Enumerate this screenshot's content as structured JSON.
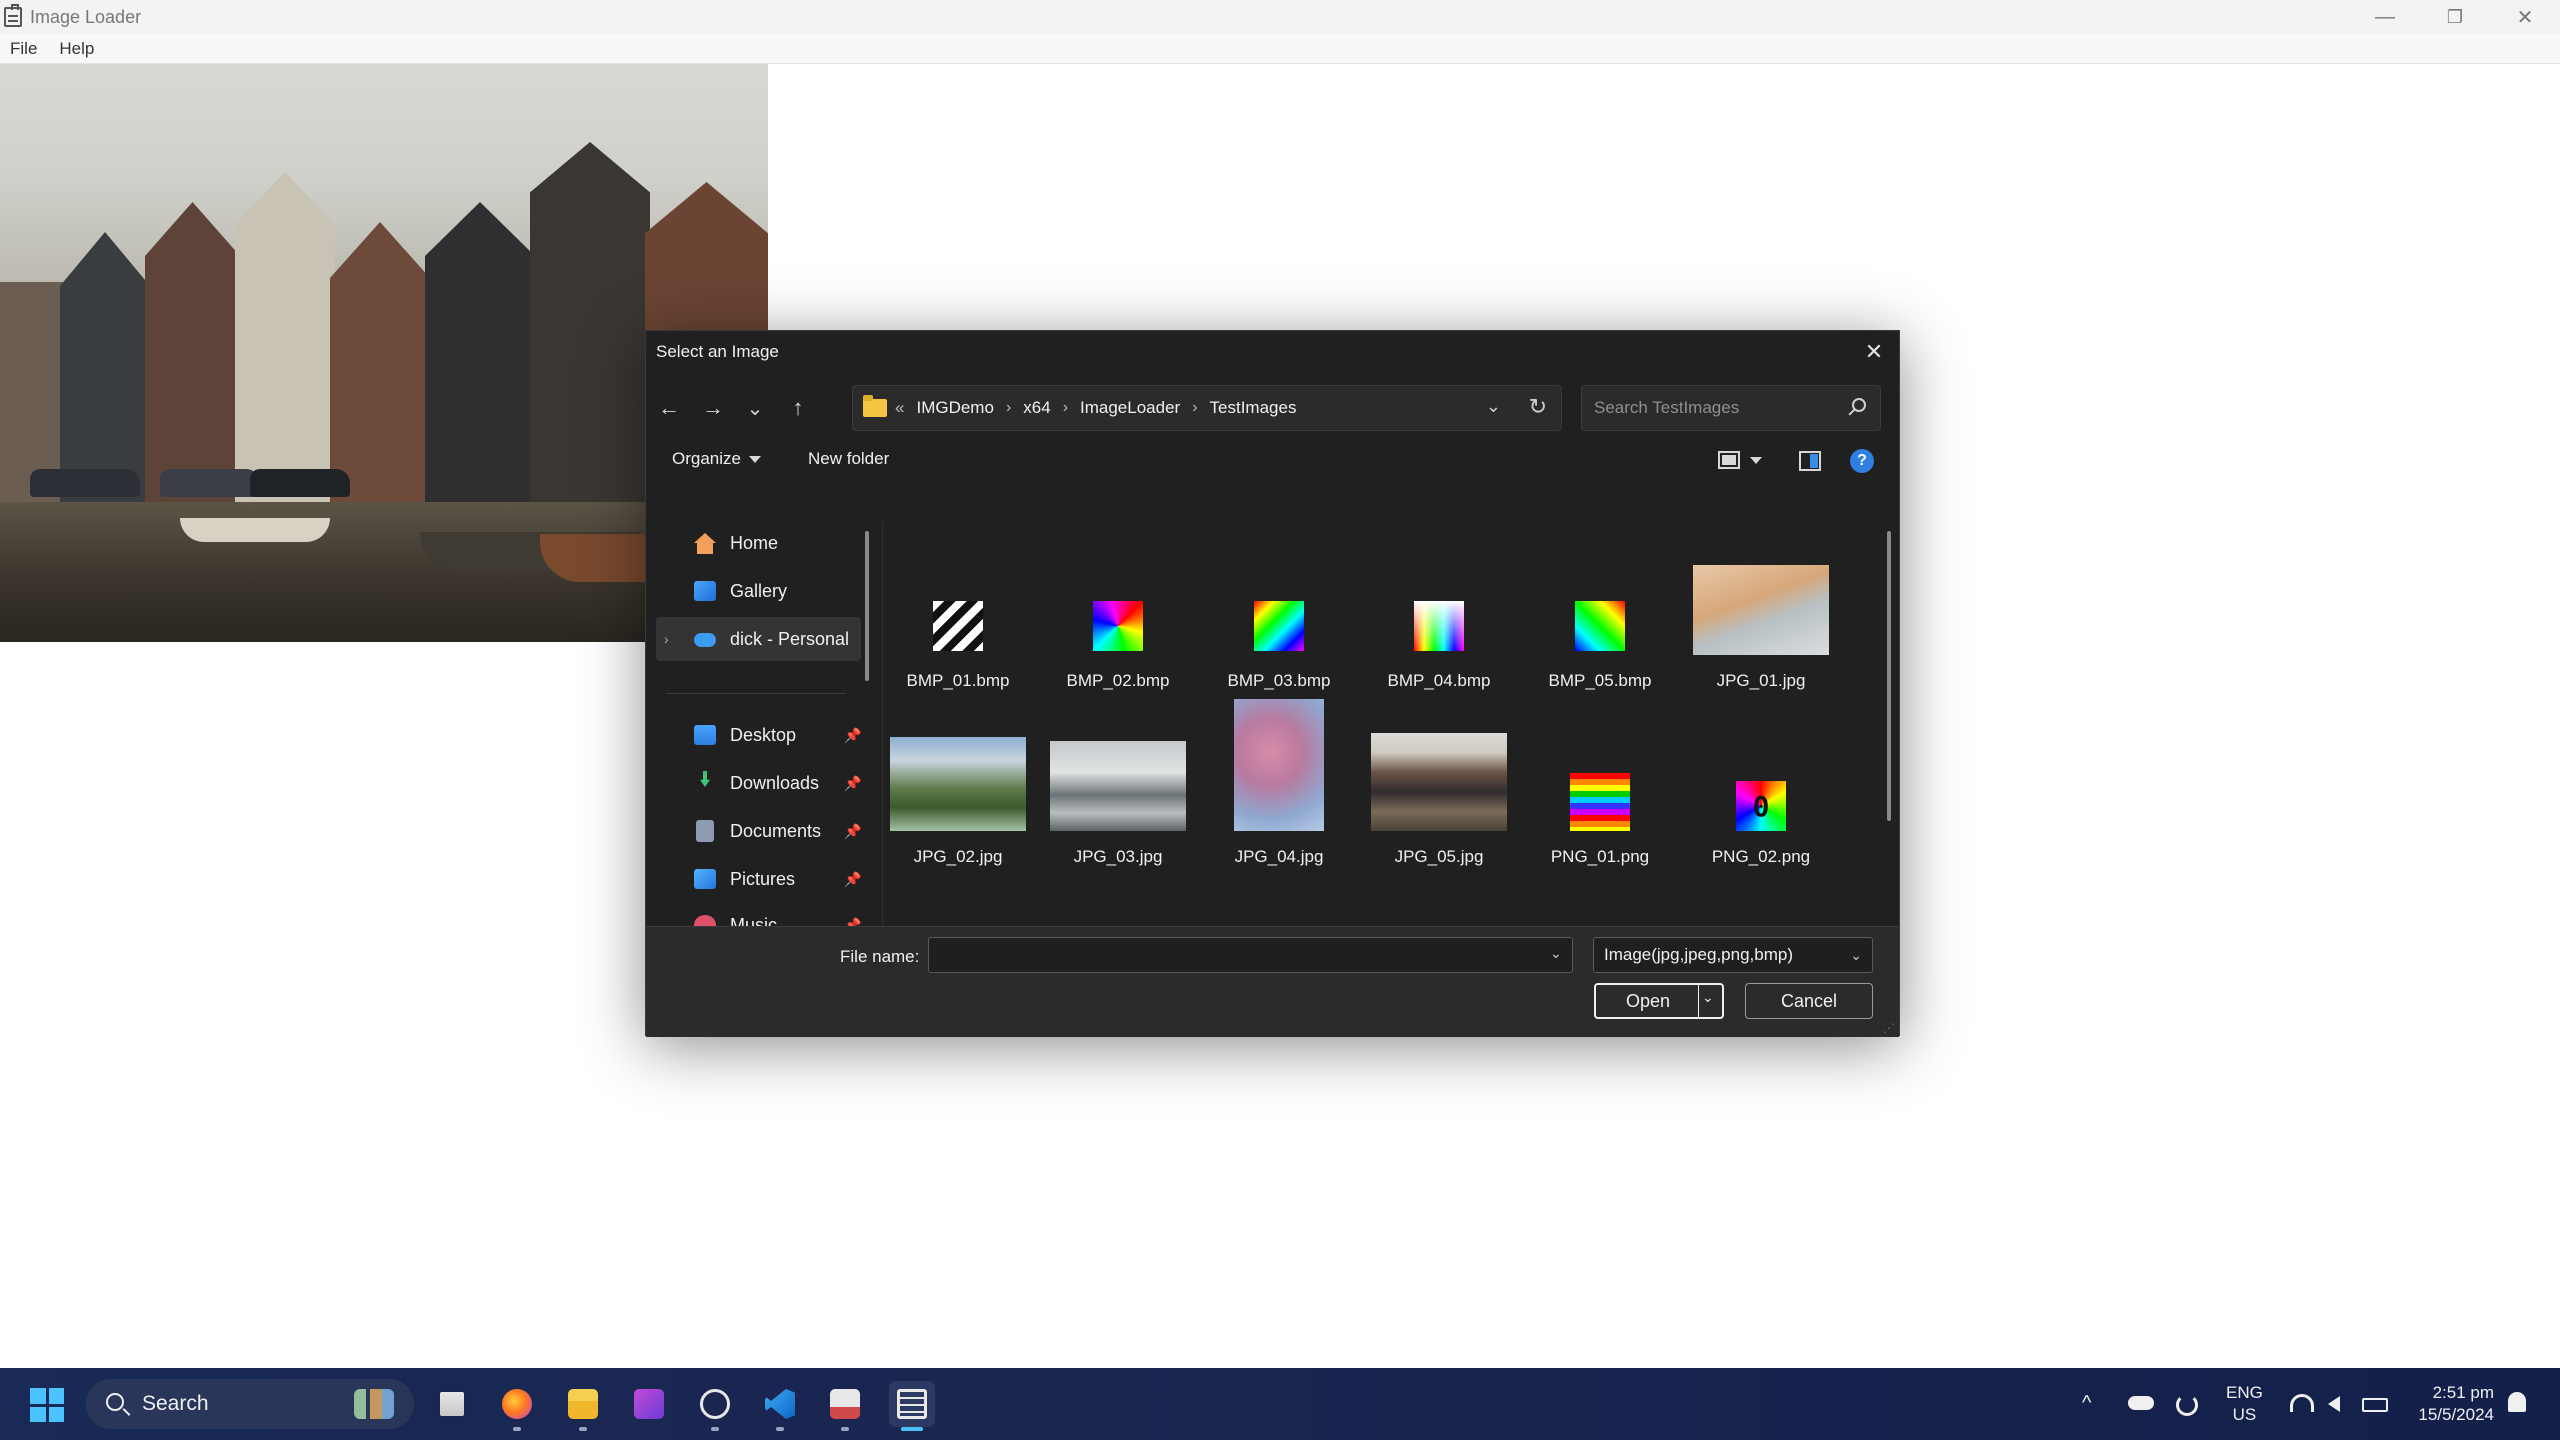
{
  "app": {
    "title": "Image Loader",
    "menu": [
      "File",
      "Help"
    ],
    "controls": {
      "minimize": "—",
      "restore": "❐",
      "close": "✕"
    }
  },
  "dialog": {
    "title": "Select an Image",
    "close_glyph": "✕",
    "nav": {
      "back": "←",
      "forward": "→",
      "recent": "⌄",
      "up": "↑"
    },
    "address": {
      "overflow": "«",
      "crumbs": [
        "IMGDemo",
        "x64",
        "ImageLoader",
        "TestImages"
      ],
      "separator": "›",
      "dropdown": "⌄",
      "refresh": "↻"
    },
    "search_placeholder": "Search TestImages",
    "commands": {
      "organize": "Organize",
      "new_folder": "New folder",
      "help": "?"
    },
    "nav_pane": {
      "home": "Home",
      "gallery": "Gallery",
      "onedrive": "dick - Personal",
      "desktop": "Desktop",
      "downloads": "Downloads",
      "documents": "Documents",
      "pictures": "Pictures",
      "music": "Music",
      "pin_glyph": "📌",
      "expand_glyph": "›"
    },
    "files": [
      {
        "name": "BMP_01.bmp"
      },
      {
        "name": "BMP_02.bmp"
      },
      {
        "name": "BMP_03.bmp"
      },
      {
        "name": "BMP_04.bmp"
      },
      {
        "name": "BMP_05.bmp"
      },
      {
        "name": "JPG_01.jpg"
      },
      {
        "name": "JPG_02.jpg"
      },
      {
        "name": "JPG_03.jpg"
      },
      {
        "name": "JPG_04.jpg"
      },
      {
        "name": "JPG_05.jpg"
      },
      {
        "name": "PNG_01.png"
      },
      {
        "name": "PNG_02.png"
      }
    ],
    "png_02_glyph": "0",
    "filename_label": "File name:",
    "filename_value": "",
    "filetype": "Image(jpg,jpeg,png,bmp)",
    "dropdown_glyph": "⌄",
    "open_label": "Open",
    "cancel_label": "Cancel"
  },
  "taskbar": {
    "search_label": "Search",
    "tray_expand": "^",
    "lang_line1": "ENG",
    "lang_line2": "US",
    "time": "2:51 pm",
    "date": "15/5/2024"
  }
}
